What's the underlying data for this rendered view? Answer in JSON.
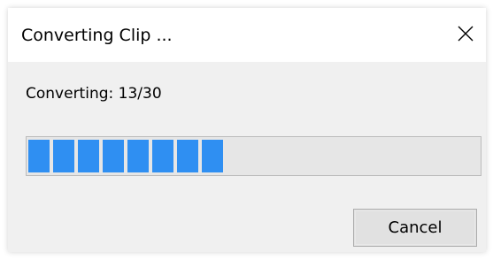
{
  "dialog": {
    "title": "Converting Clip ...",
    "close_icon": "close-icon",
    "status_text": "Converting: 13/30",
    "progress": {
      "current": 13,
      "total": 30,
      "fraction": 0.43,
      "visible_segments": 8,
      "fill_color": "#2f8ff2"
    },
    "cancel_label": "Cancel"
  }
}
